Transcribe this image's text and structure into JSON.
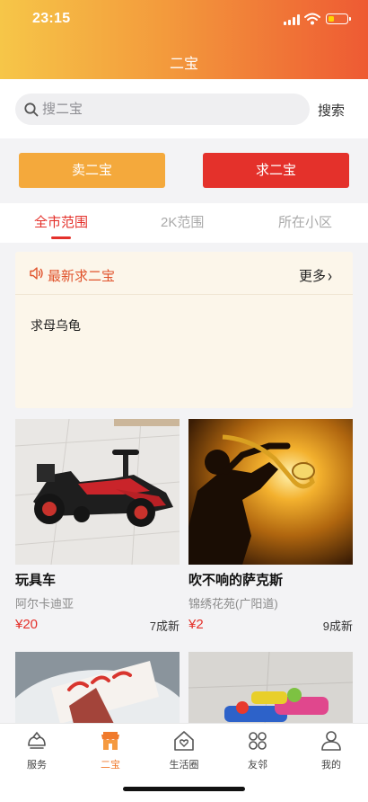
{
  "status_bar": {
    "time": "23:15",
    "battery_color": "#ffd400"
  },
  "header": {
    "title": "二宝",
    "gradient": [
      "#f6c648",
      "#ee5a33"
    ]
  },
  "search": {
    "placeholder": "搜二宝",
    "value": "",
    "button_label": "搜索",
    "icon": "search-icon"
  },
  "actions": {
    "sell_label": "卖二宝",
    "sell_color": "#f4a93c",
    "want_label": "求二宝",
    "want_color": "#e4312b"
  },
  "tabs": [
    {
      "label": "全市范围",
      "active": true
    },
    {
      "label": "2K范围",
      "active": false
    },
    {
      "label": "所在小区",
      "active": false
    }
  ],
  "notice": {
    "icon": "speaker-icon",
    "title": "最新求二宝",
    "more_label": "更多",
    "items": [
      "求母乌龟"
    ]
  },
  "products": [
    {
      "name": "玩具车",
      "location": "阿尔卡迪亚",
      "price": "¥20",
      "condition": "7成新",
      "image": "toy-ride-on-car"
    },
    {
      "name": "吹不响的萨克斯",
      "location": "锦绣花苑(广阳道)",
      "price": "¥2",
      "condition": "9成新",
      "image": "saxophone-silhouette"
    },
    {
      "name": "",
      "location": "",
      "price": "",
      "condition": "",
      "image": "cake"
    },
    {
      "name": "",
      "location": "",
      "price": "",
      "condition": "",
      "image": "toy-water-guns"
    }
  ],
  "tabbar": [
    {
      "label": "服务",
      "icon": "service-icon",
      "active": false
    },
    {
      "label": "二宝",
      "icon": "shop-icon",
      "active": true
    },
    {
      "label": "生活圈",
      "icon": "house-heart-icon",
      "active": false
    },
    {
      "label": "友邻",
      "icon": "grid-icon",
      "active": false
    },
    {
      "label": "我的",
      "icon": "person-icon",
      "active": false
    }
  ],
  "accent_color": "#e4312b"
}
